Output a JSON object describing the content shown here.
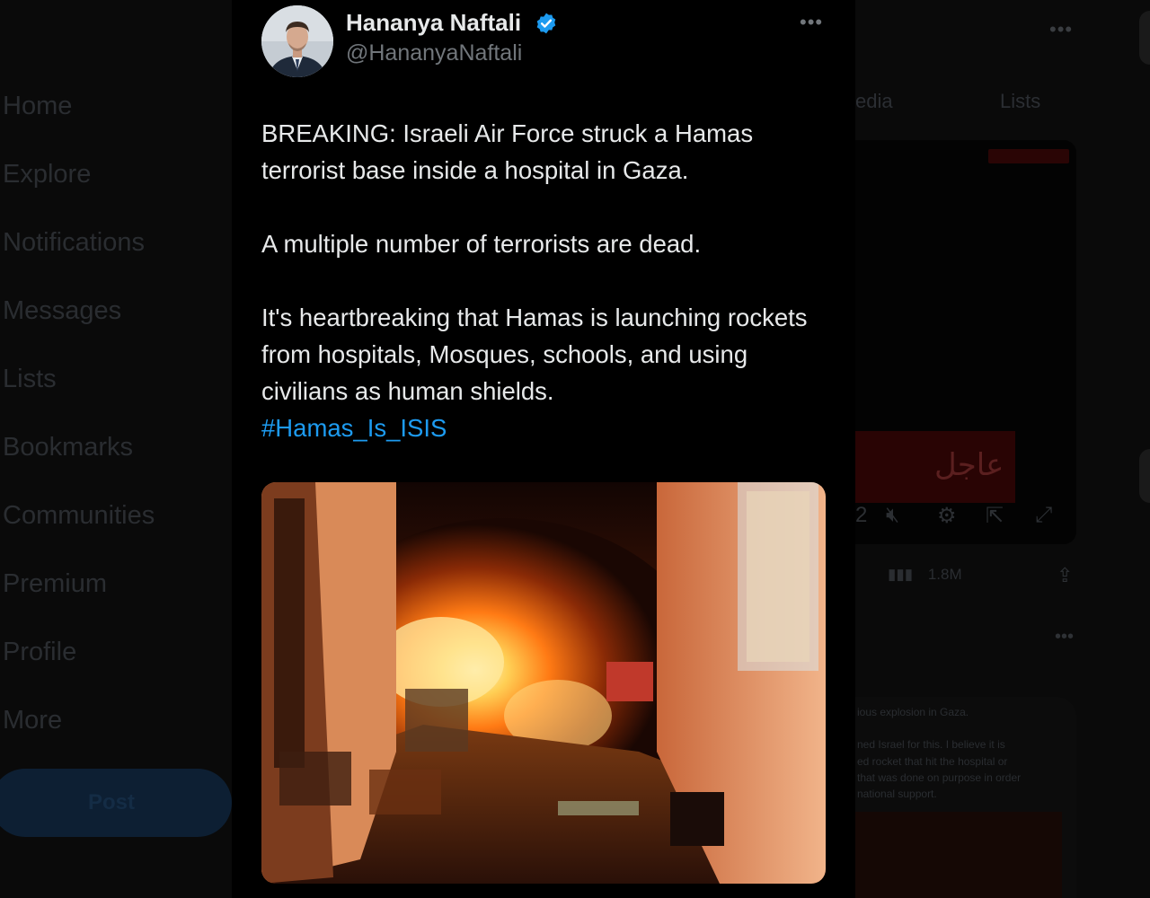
{
  "nav": {
    "items": [
      "Home",
      "Explore",
      "Notifications",
      "Messages",
      "Lists",
      "Bookmarks",
      "Communities",
      "Premium",
      "Profile",
      "More"
    ],
    "post_label": "Post"
  },
  "profile_tabs": {
    "media_partial": "edia",
    "lists": "Lists"
  },
  "video": {
    "overlay_text": "عاجل",
    "counter_partial": "2"
  },
  "side_stats": {
    "views": "1.8M"
  },
  "reply_preview": {
    "line1": "ious explosion in Gaza.",
    "line2": "ned Israel for this. I believe it is",
    "line3": "ed rocket that hit the hospital or",
    "line4": "that was done on purpose in order",
    "line5": "national support."
  },
  "tweet": {
    "author_name": "Hananya Naftali",
    "author_handle": "@HananyaNaftali",
    "verified": true,
    "paragraph1": "BREAKING: Israeli Air Force struck a Hamas terrorist base inside a hospital in Gaza.",
    "paragraph2": "A multiple number of terrorists are dead.",
    "paragraph3": "It's heartbreaking that Hamas is launching rockets from hospitals, Mosques, schools, and using civilians as human shields.",
    "hashtag": "#Hamas_Is_ISIS",
    "accent_color": "#1d9bf0"
  }
}
